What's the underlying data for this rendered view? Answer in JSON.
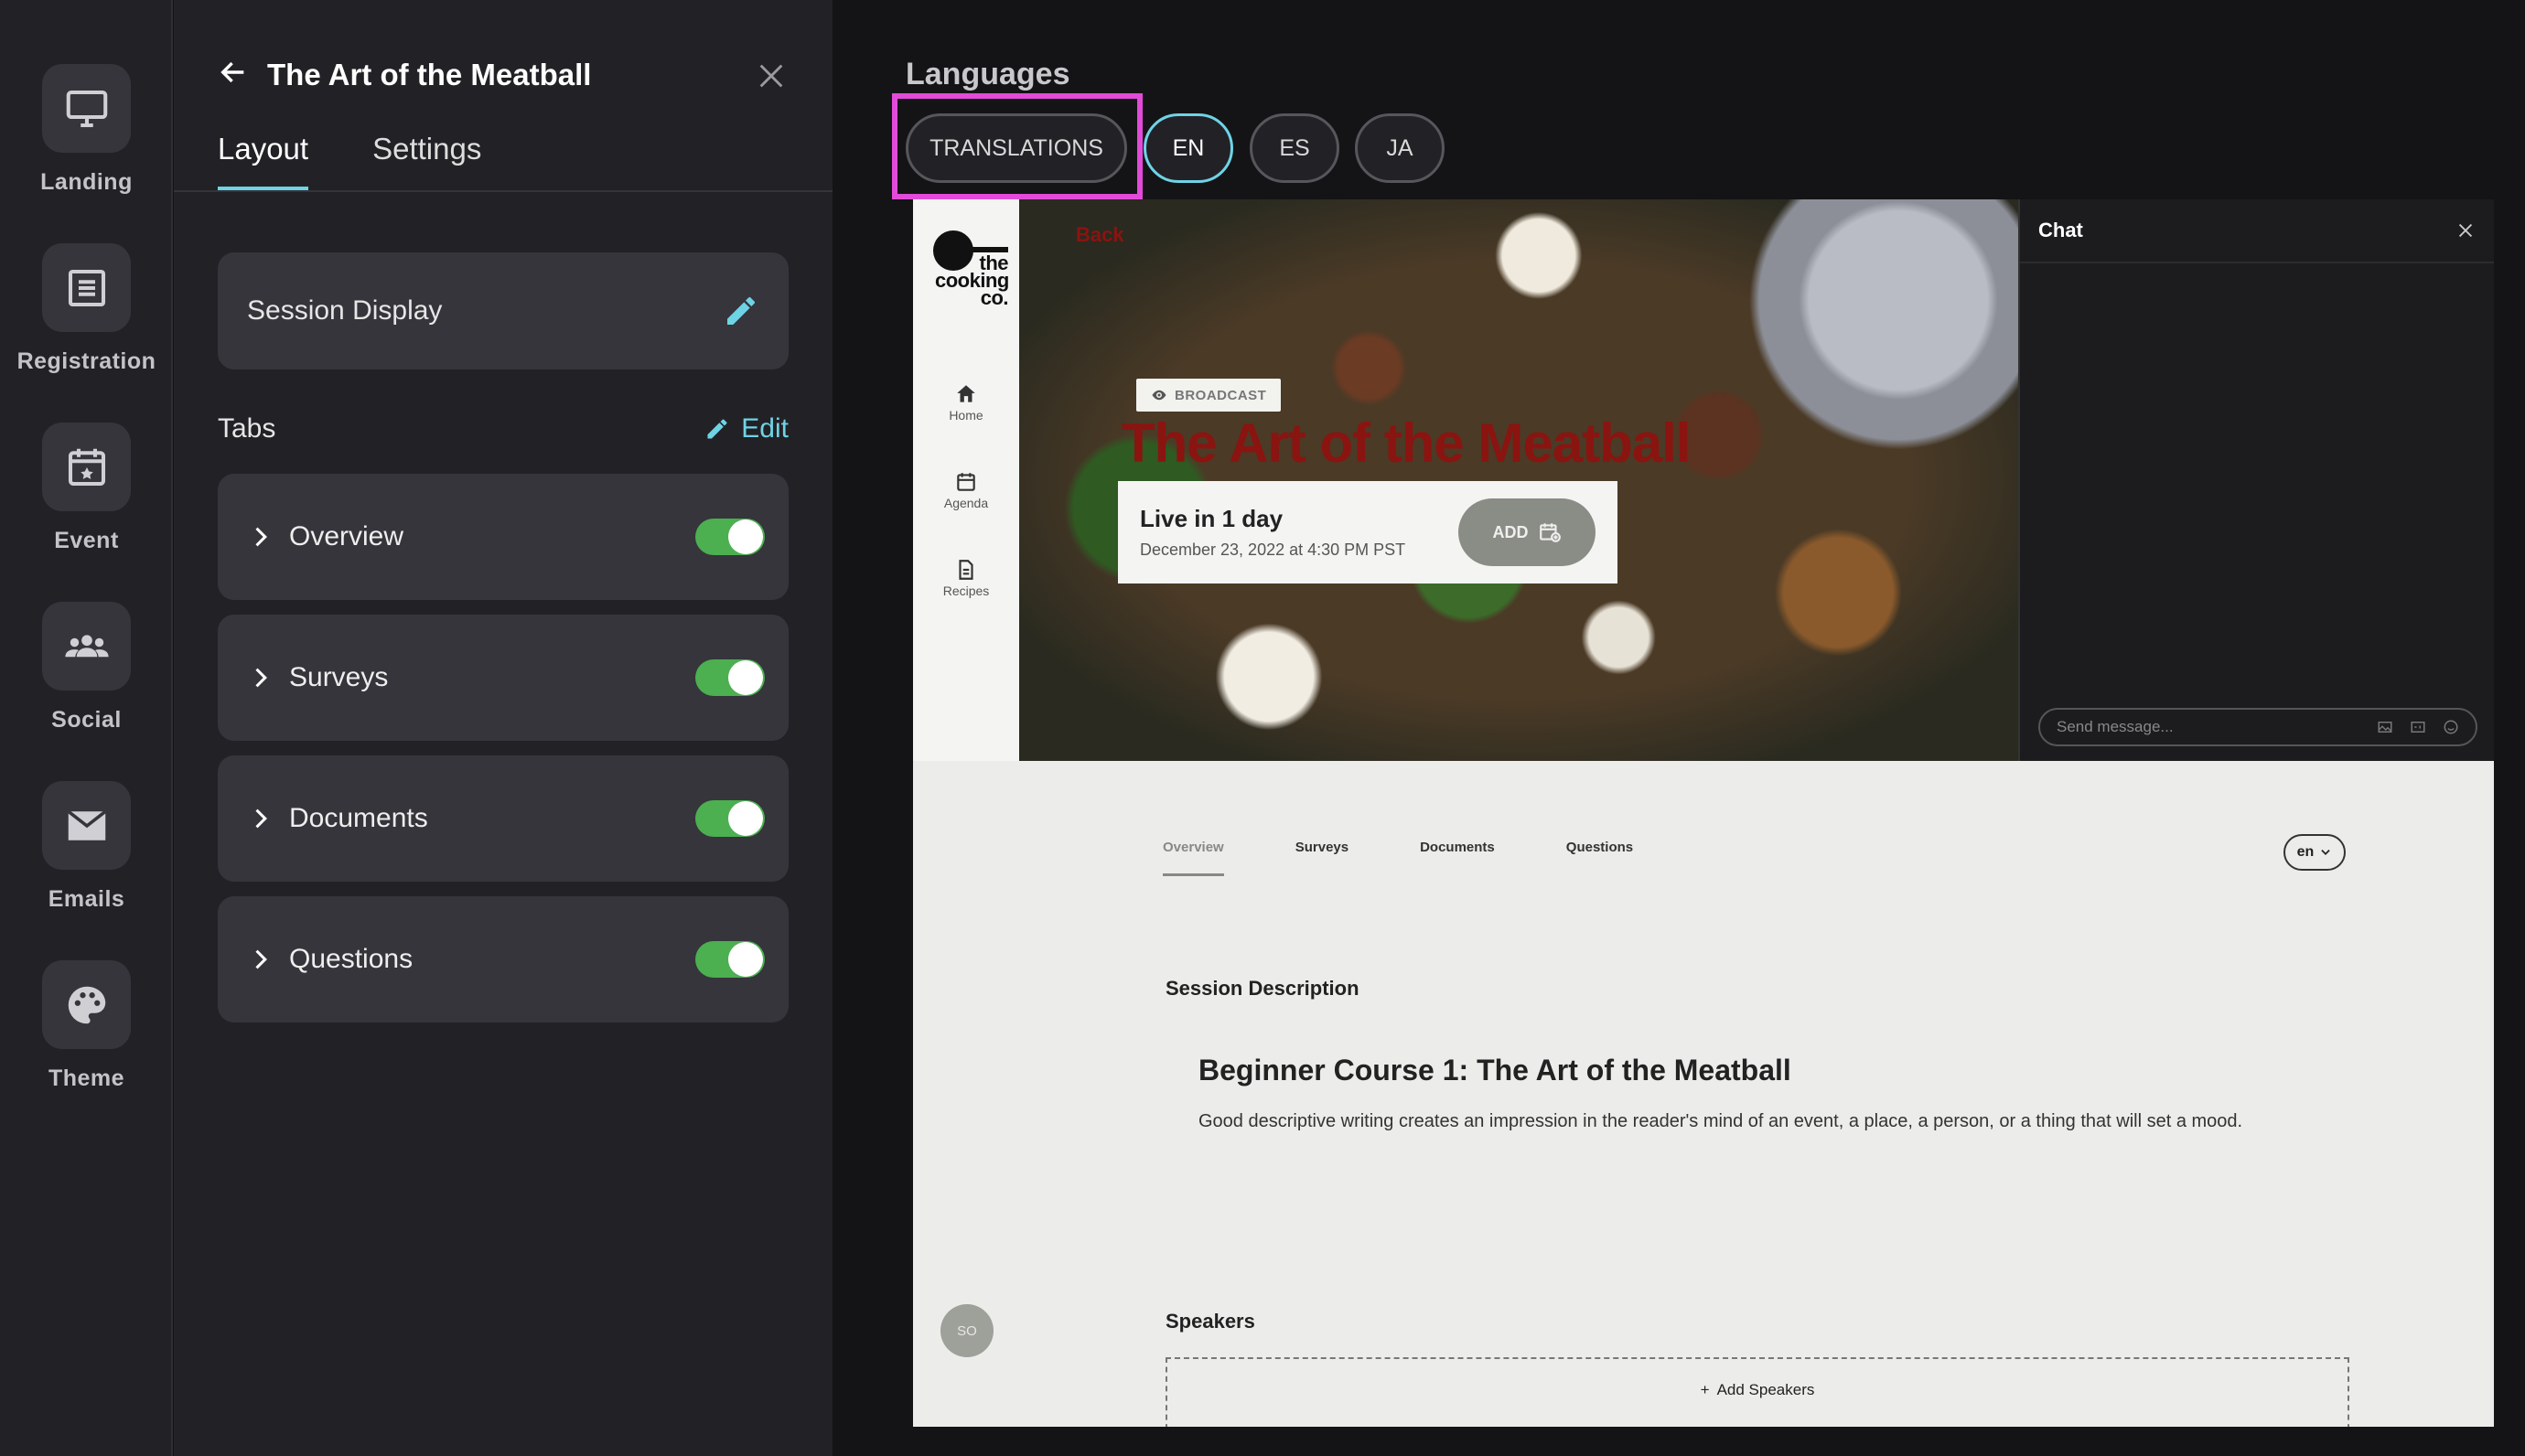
{
  "nav": {
    "items": [
      {
        "label": "Landing",
        "icon": "monitor-icon"
      },
      {
        "label": "Registration",
        "icon": "list-icon"
      },
      {
        "label": "Event",
        "icon": "calendar-icon"
      },
      {
        "label": "Social",
        "icon": "people-icon"
      },
      {
        "label": "Emails",
        "icon": "mail-icon"
      },
      {
        "label": "Theme",
        "icon": "palette-icon"
      }
    ]
  },
  "panel": {
    "title": "The Art of the Meatball",
    "tabs": [
      {
        "label": "Layout",
        "active": true
      },
      {
        "label": "Settings",
        "active": false
      }
    ],
    "session_display": "Session Display",
    "tabs_section": {
      "label": "Tabs",
      "edit_label": "Edit"
    },
    "tab_rows": [
      {
        "label": "Overview",
        "enabled": true
      },
      {
        "label": "Surveys",
        "enabled": true
      },
      {
        "label": "Documents",
        "enabled": true
      },
      {
        "label": "Questions",
        "enabled": true
      }
    ]
  },
  "languages": {
    "title": "Languages",
    "buttons": [
      {
        "label": "TRANSLATIONS",
        "active": false
      },
      {
        "label": "EN",
        "active": true
      },
      {
        "label": "ES",
        "active": false
      },
      {
        "label": "JA",
        "active": false
      }
    ],
    "highlight_color": "#e24bd9"
  },
  "preview": {
    "logo": {
      "text": "the cooking co."
    },
    "side_nav": [
      {
        "label": "Home",
        "icon": "home-icon"
      },
      {
        "label": "Agenda",
        "icon": "calendar-icon"
      },
      {
        "label": "Recipes",
        "icon": "document-icon"
      }
    ],
    "back_label": "Back",
    "badge": "BROADCAST",
    "hero_title": "The Art of the Meatball",
    "live": {
      "title": "Live in 1 day",
      "date": "December 23, 2022 at 4:30 PM PST",
      "add_label": "ADD"
    },
    "chat": {
      "title": "Chat",
      "placeholder": "Send message..."
    },
    "tabs": [
      {
        "label": "Overview",
        "active": true
      },
      {
        "label": "Surveys",
        "active": false
      },
      {
        "label": "Documents",
        "active": false
      },
      {
        "label": "Questions",
        "active": false
      }
    ],
    "lang_select": "en",
    "session_description_heading": "Session Description",
    "course_title": "Beginner Course 1: The Art of the Meatball",
    "course_desc": "Good descriptive writing creates an impression in the reader's mind of an event, a place, a person, or a thing that will set a mood.",
    "speakers_heading": "Speakers",
    "avatar_initials": "SO",
    "add_speakers": "Add Speakers"
  },
  "colors": {
    "accent": "#6fd3e6",
    "toggle_on": "#4caf50",
    "brand_red": "#8a1410"
  }
}
